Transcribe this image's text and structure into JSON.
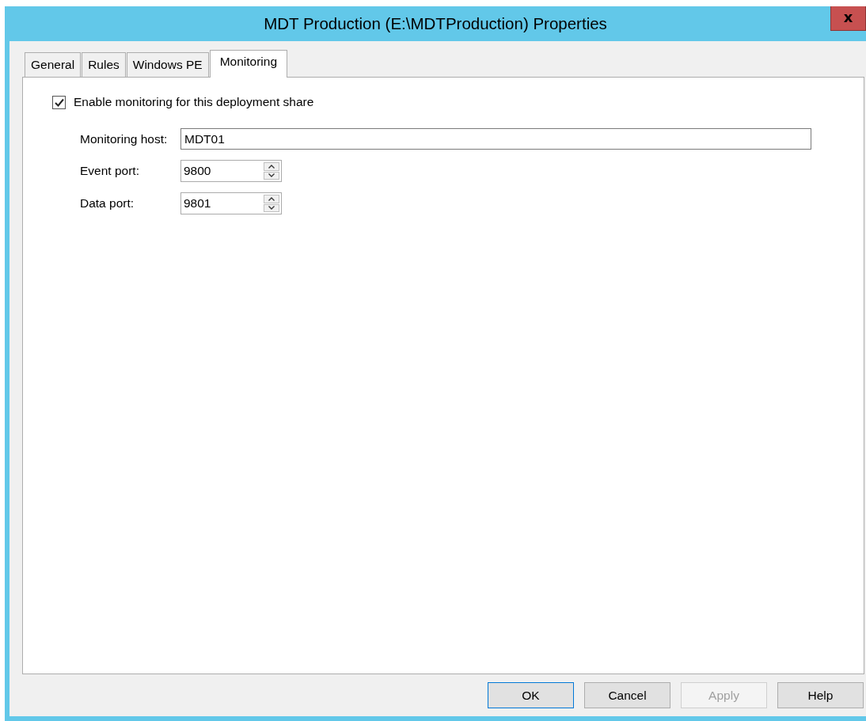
{
  "window": {
    "title": "MDT Production (E:\\MDTProduction) Properties",
    "close": "x"
  },
  "tabs": [
    {
      "label": "General",
      "selected": false
    },
    {
      "label": "Rules",
      "selected": false
    },
    {
      "label": "Windows PE",
      "selected": false
    },
    {
      "label": "Monitoring",
      "selected": true
    }
  ],
  "enable_monitoring": {
    "label": "Enable monitoring for this deployment share",
    "checked": true
  },
  "fields": [
    {
      "kind": "text",
      "label": "Monitoring host:",
      "value": "MDT01"
    },
    {
      "kind": "spin",
      "label": "Event port:",
      "value": "9800"
    },
    {
      "kind": "spin",
      "label": "Data port:",
      "value": "9801"
    }
  ],
  "buttons": [
    {
      "label": "OK",
      "default": true,
      "disabled": false
    },
    {
      "label": "Cancel",
      "default": false,
      "disabled": false
    },
    {
      "label": "Apply",
      "default": false,
      "disabled": true
    },
    {
      "label": "Help",
      "default": false,
      "disabled": false
    }
  ]
}
